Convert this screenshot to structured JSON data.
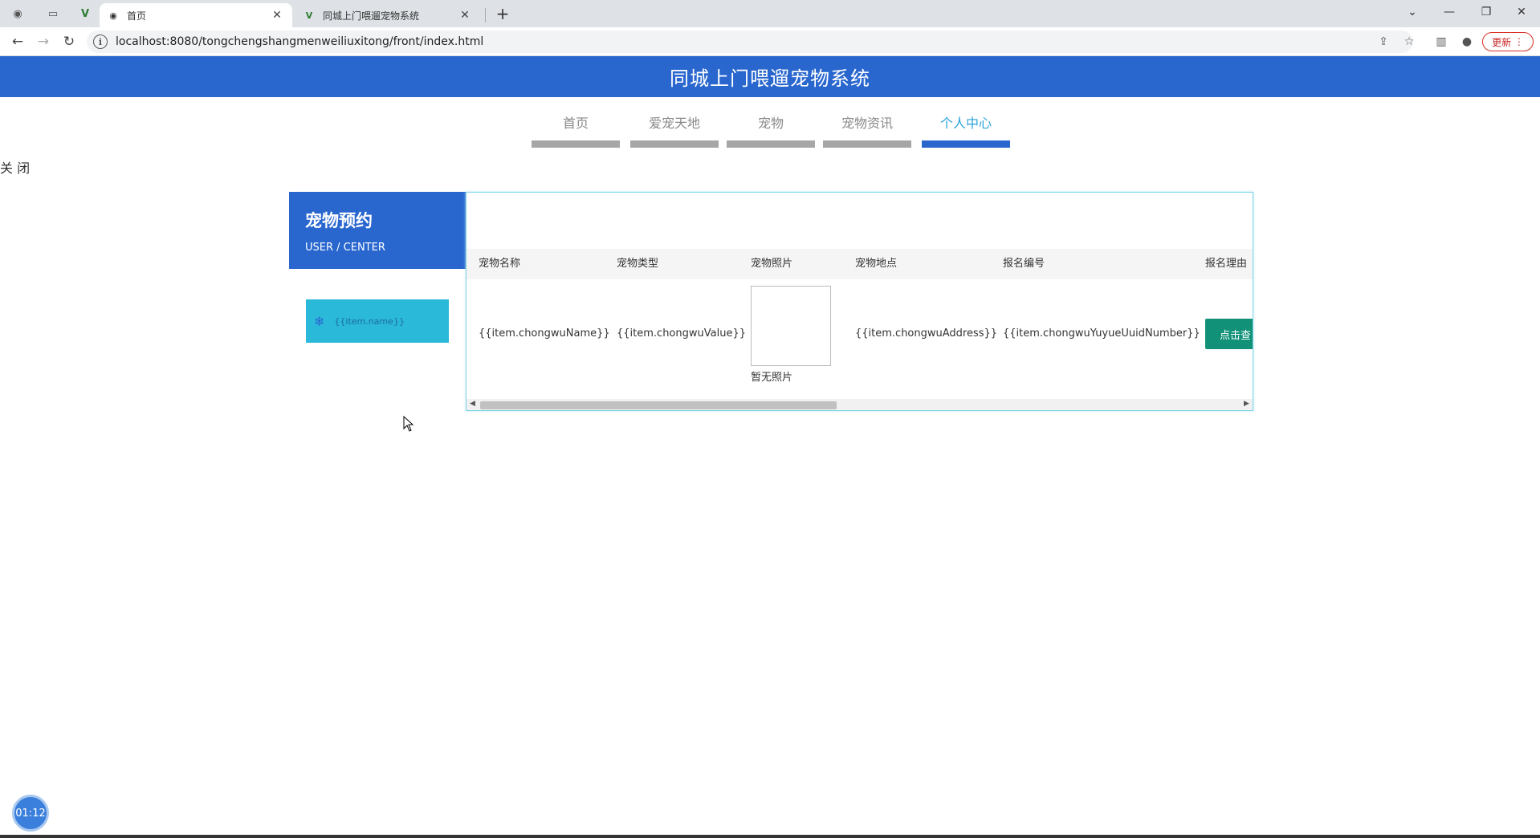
{
  "browser": {
    "tabs": [
      {
        "title": "首页",
        "active": true
      },
      {
        "title": "同城上门喂遛宠物系统",
        "active": false
      }
    ],
    "url": "localhost:8080/tongchengshangmenweiliuxitong/front/index.html",
    "update_label": "更新"
  },
  "header": {
    "title": "同城上门喂遛宠物系统"
  },
  "nav": {
    "items": [
      {
        "label": "首页"
      },
      {
        "label": "爱宠天地"
      },
      {
        "label": "宠物"
      },
      {
        "label": "宠物资讯"
      },
      {
        "label": "个人中心"
      }
    ],
    "active_index": 4
  },
  "close_label": "关 闭",
  "sidebar": {
    "heading": "宠物预约",
    "subheading": "USER / CENTER",
    "item_label": "{{item.name}}"
  },
  "table": {
    "columns": [
      "宠物名称",
      "宠物类型",
      "宠物照片",
      "宠物地点",
      "报名编号",
      "报名理由"
    ],
    "row": {
      "name": "{{item.chongwuName}}",
      "type": "{{item.chongwuValue}}",
      "photo_caption": "暂无照片",
      "address": "{{item.chongwuAddress}}",
      "number": "{{item.chongwuYuyueUuidNumber}}",
      "reason_button": "点击查"
    }
  },
  "timer": "01:12",
  "colors": {
    "primary": "#2967cf",
    "accent": "#2bb9d9",
    "button": "#119178"
  }
}
